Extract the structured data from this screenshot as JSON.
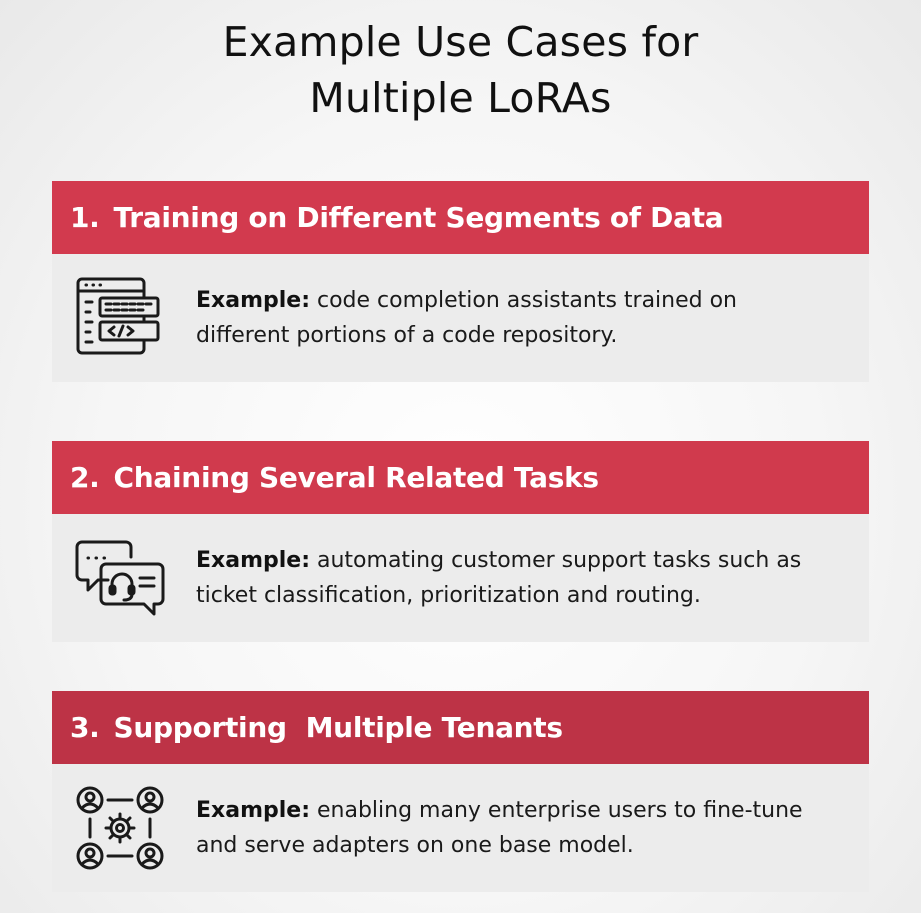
{
  "title": {
    "line1": "Example Use Cases for",
    "line2": "Multiple LoRAs"
  },
  "cards": [
    {
      "number": "1.",
      "heading": "Training on Different Segments of Data",
      "example_label": "Example:",
      "example_text": "code completion assistants trained on different portions of a code repository.",
      "icon": "code-window-icon"
    },
    {
      "number": "2.",
      "heading": "Chaining Several Related Tasks",
      "example_label": "Example:",
      "example_text": "automating customer support tasks such as ticket classification, prioritization and routing.",
      "icon": "support-chat-icon"
    },
    {
      "number": "3.",
      "heading": "Supporting  Multiple Tenants",
      "example_label": "Example:",
      "example_text": "enabling many enterprise users to fine-tune and serve adapters on one base model.",
      "icon": "multi-user-gear-icon"
    }
  ],
  "colors": {
    "header_red": "#d23a4e",
    "body_gray": "#ececec",
    "text": "#111111"
  }
}
